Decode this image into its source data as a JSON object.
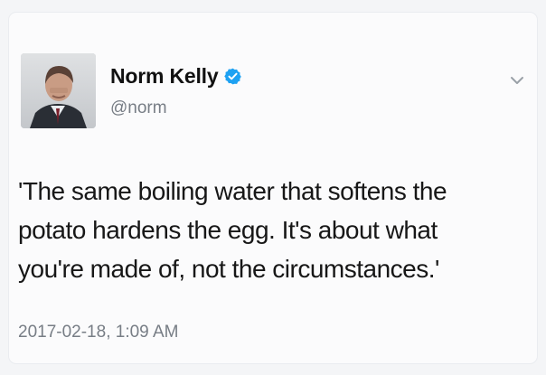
{
  "tweet": {
    "author": {
      "display_name": "Norm Kelly",
      "handle": "@norm",
      "verified_icon": "verified-badge-icon",
      "avatar": "avatar-photo"
    },
    "menu_icon": "chevron-down-icon",
    "text": "'The same boiling water that softens the\npotato hardens the egg. It's about what\nyou're made of, not the circumstances.'",
    "timestamp": "2017-02-18, 1:09 AM"
  },
  "colors": {
    "background": "#f4f5f7",
    "card": "#fbfbfc",
    "text": "#171717",
    "muted": "#777d85",
    "verified": "#1da1f2"
  }
}
